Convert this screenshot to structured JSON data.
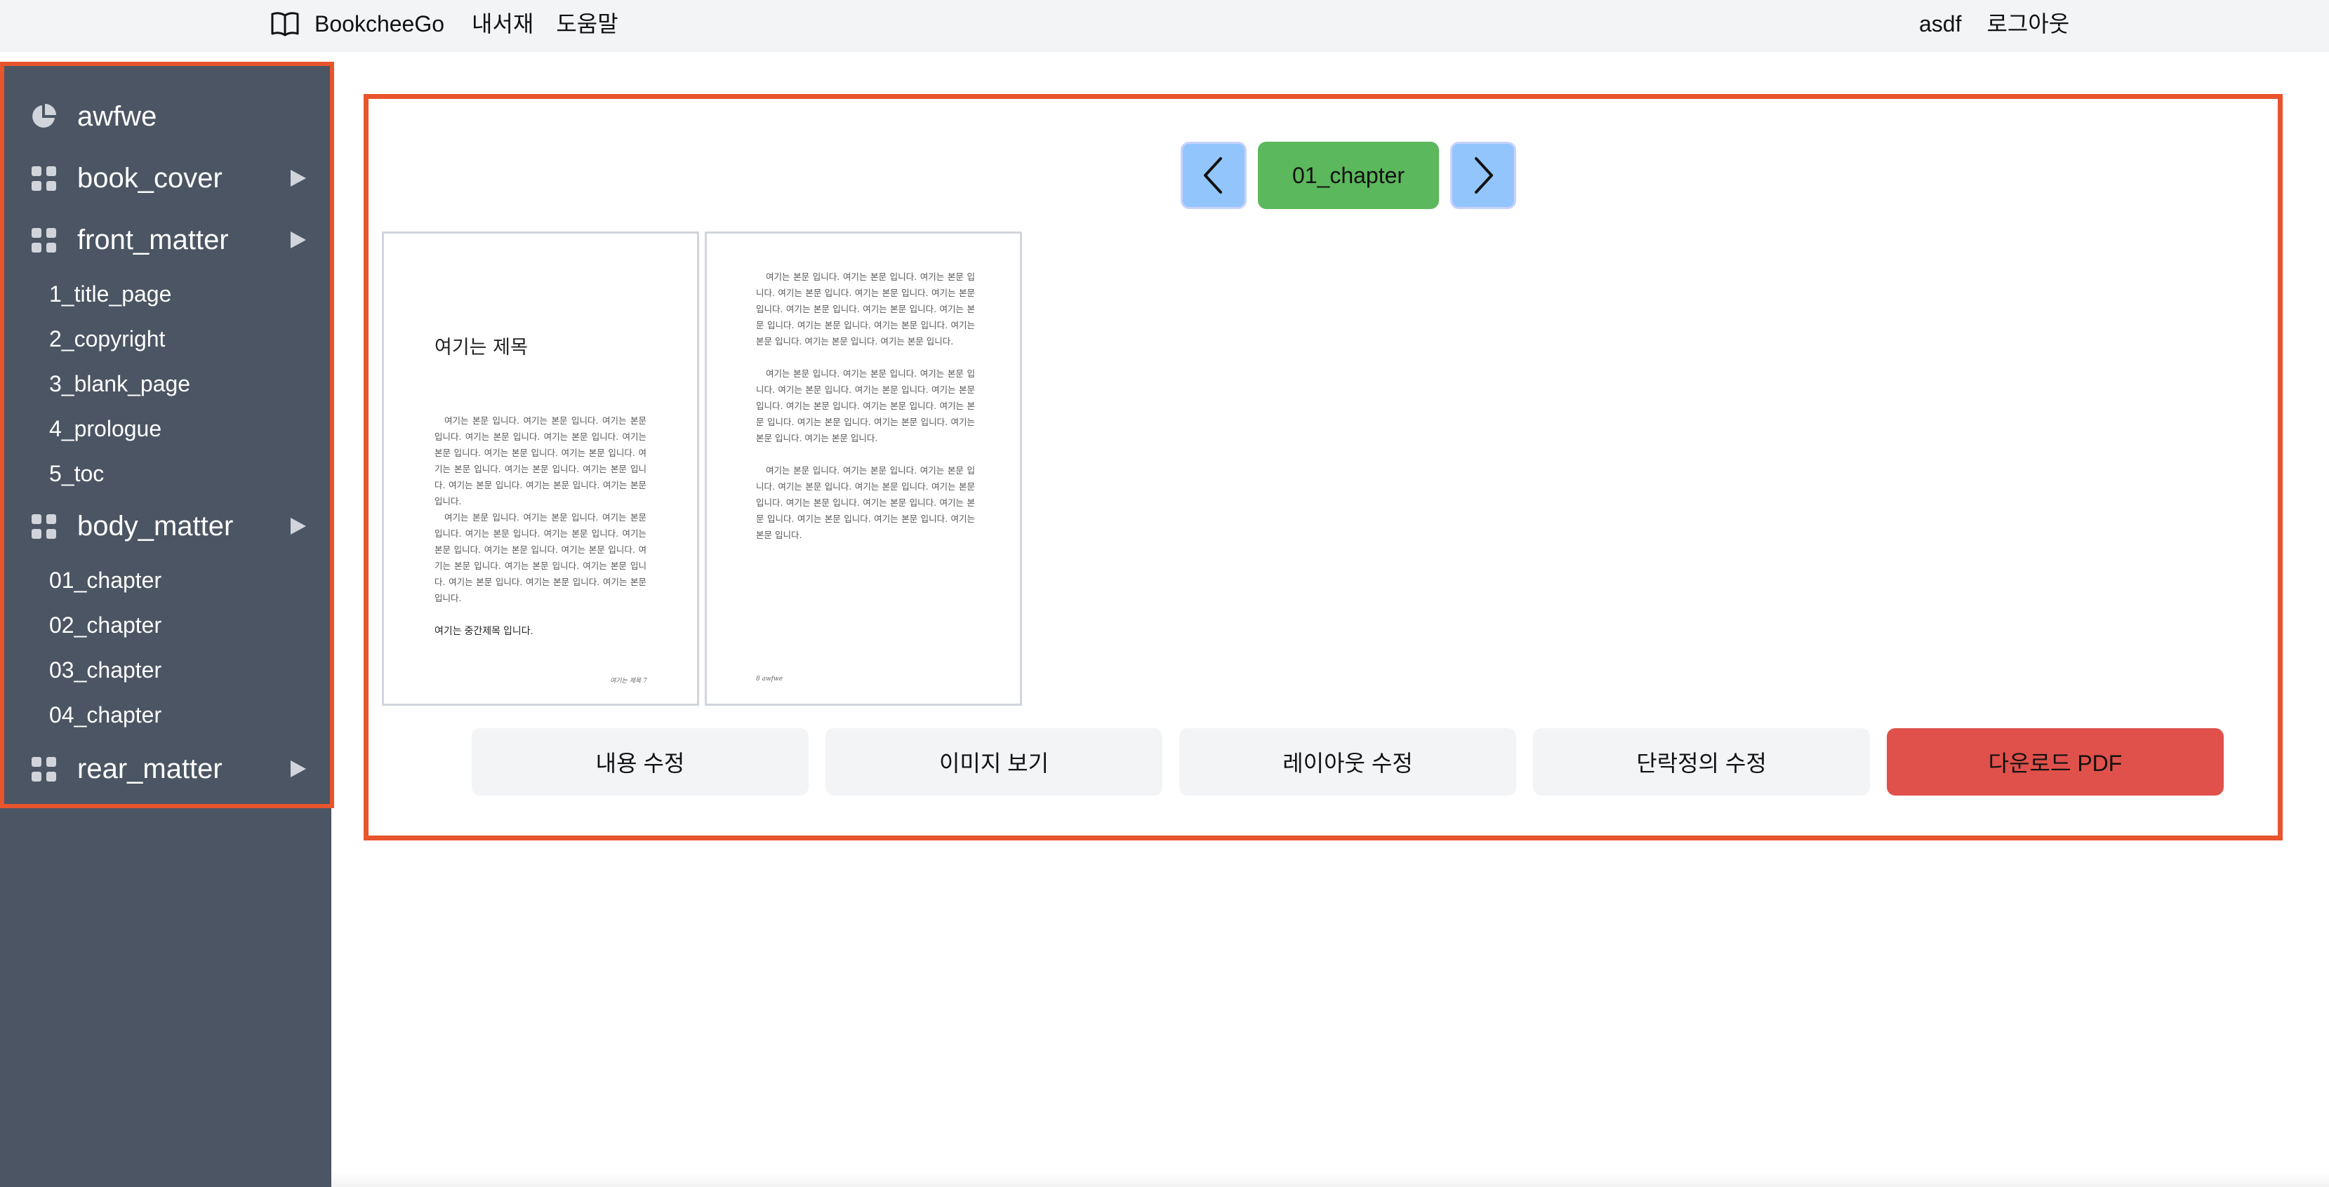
{
  "header": {
    "brand": "BookcheeGo",
    "nav_links": [
      "내서재",
      "도움말"
    ],
    "user_name": "asdf",
    "logout_label": "로그아웃"
  },
  "sidebar": {
    "project": "awfwe",
    "sections": [
      {
        "label": "book_cover",
        "items": []
      },
      {
        "label": "front_matter",
        "items": [
          "1_title_page",
          "2_copyright",
          "3_blank_page",
          "4_prologue",
          "5_toc"
        ]
      },
      {
        "label": "body_matter",
        "items": [
          "01_chapter",
          "02_chapter",
          "03_chapter",
          "04_chapter"
        ]
      },
      {
        "label": "rear_matter",
        "items": []
      }
    ]
  },
  "viewer": {
    "current_chapter": "01_chapter",
    "pages": [
      {
        "title": "여기는 제목",
        "body_1": "여기는 본문 입니다. 여기는 본문 입니다. 여기는 본문 입니다. 여기는 본문 입니다. 여기는 본문 입니다. 여기는 본문 입니다. 여기는 본문 입니다. 여기는 본문 입니다. 여기는 본문 입니다. 여기는 본문 입니다. 여기는 본문 입니다. 여기는 본문 입니다. 여기는 본문 입니다. 여기는 본문 입니다.",
        "body_2": "여기는 본문 입니다. 여기는 본문 입니다. 여기는 본문 입니다. 여기는 본문 입니다. 여기는 본문 입니다. 여기는 본문 입니다. 여기는 본문 입니다. 여기는 본문 입니다. 여기는 본문 입니다. 여기는 본문 입니다. 여기는 본문 입니다. 여기는 본문 입니다. 여기는 본문 입니다. 여기는 본문 입니다.",
        "subtitle": "여기는 중간제목 입니다.",
        "footer": "여기는 제목 7"
      },
      {
        "body_1": "여기는 본문 입니다. 여기는 본문 입니다. 여기는 본문 입니다. 여기는 본문 입니다. 여기는 본문 입니다. 여기는 본문 입니다. 여기는 본문 입니다. 여기는 본문 입니다. 여기는 본문 입니다. 여기는 본문 입니다. 여기는 본문 입니다. 여기는 본문 입니다. 여기는 본문 입니다. 여기는 본문 입니다.",
        "body_2": "여기는 본문 입니다. 여기는 본문 입니다. 여기는 본문 입니다. 여기는 본문 입니다. 여기는 본문 입니다. 여기는 본문 입니다. 여기는 본문 입니다. 여기는 본문 입니다. 여기는 본문 입니다. 여기는 본문 입니다. 여기는 본문 입니다. 여기는 본문 입니다. 여기는 본문 입니다.",
        "body_3": "여기는 본문 입니다. 여기는 본문 입니다. 여기는 본문 입니다. 여기는 본문 입니다. 여기는 본문 입니다. 여기는 본문 입니다. 여기는 본문 입니다. 여기는 본문 입니다. 여기는 본문 입니다. 여기는 본문 입니다. 여기는 본문 입니다. 여기는 본문 입니다.",
        "footer": "8 awfwe"
      }
    ]
  },
  "actions": {
    "edit_content": "내용 수정",
    "view_images": "이미지 보기",
    "edit_layout": "레이아웃 수정",
    "edit_paragraph": "단락정의 수정",
    "download_pdf": "다운로드 PDF"
  },
  "colors": {
    "accent_frame": "#e8542c",
    "sidebar_bg": "#4b5563",
    "chapter_badge": "#5cb85c",
    "pager_button": "#93c5fd",
    "download_button": "#e0514b"
  }
}
